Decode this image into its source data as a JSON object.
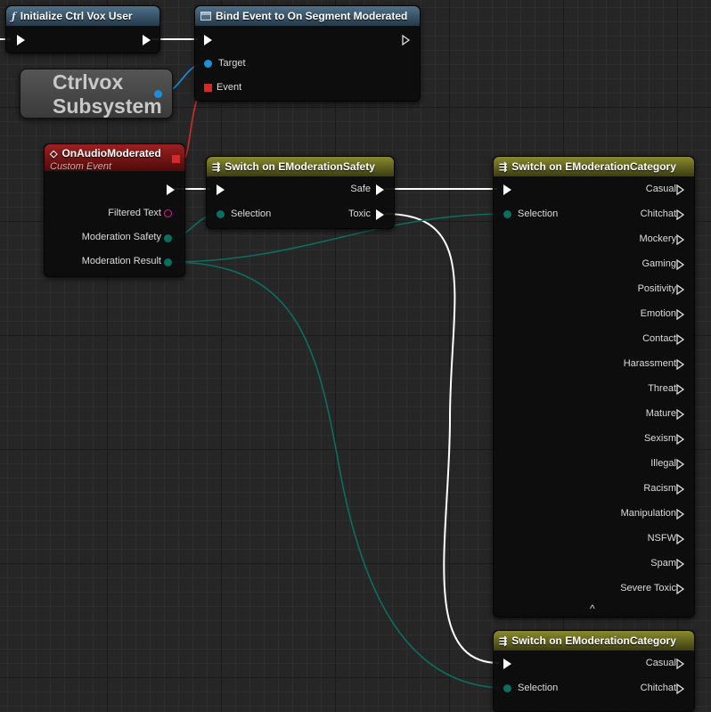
{
  "nodes": {
    "init": {
      "title": "Initialize Ctrl Vox User",
      "icon": "function-icon"
    },
    "bind": {
      "title": "Bind Event to On Segment Moderated",
      "pins": {
        "target": "Target",
        "event": "Event"
      }
    },
    "subsystem": {
      "line1": "Ctrlvox",
      "line2": "Subsystem"
    },
    "event": {
      "title": "OnAudioModerated",
      "subtitle": "Custom Event",
      "pins": {
        "filtered_text": "Filtered Text",
        "moderation_safety": "Moderation Safety",
        "moderation_result": "Moderation Result"
      }
    },
    "switch_safety": {
      "title": "Switch on EModerationSafety",
      "input": "Selection",
      "outputs": [
        "Safe",
        "Toxic"
      ]
    },
    "switch_category_1": {
      "title": "Switch on EModerationCategory",
      "input": "Selection",
      "outputs": [
        "Casual",
        "Chitchat",
        "Mockery",
        "Gaming",
        "Positivity",
        "Emotion",
        "Contact",
        "Harassment",
        "Threat",
        "Mature",
        "Sexism",
        "Illegal",
        "Racism",
        "Manipulation",
        "NSFW",
        "Spam",
        "Severe Toxic"
      ],
      "collapse_glyph": "^"
    },
    "switch_category_2": {
      "title": "Switch on EModerationCategory",
      "input": "Selection",
      "outputs": [
        "Casual",
        "Chitchat"
      ]
    }
  },
  "colors": {
    "exec_wire": "#ffffff",
    "enum_wire": "#0a6b5c",
    "object_wire": "#1d8fd6",
    "delegate_wire": "#d62a2a",
    "string_pin": "#e01a9a"
  }
}
